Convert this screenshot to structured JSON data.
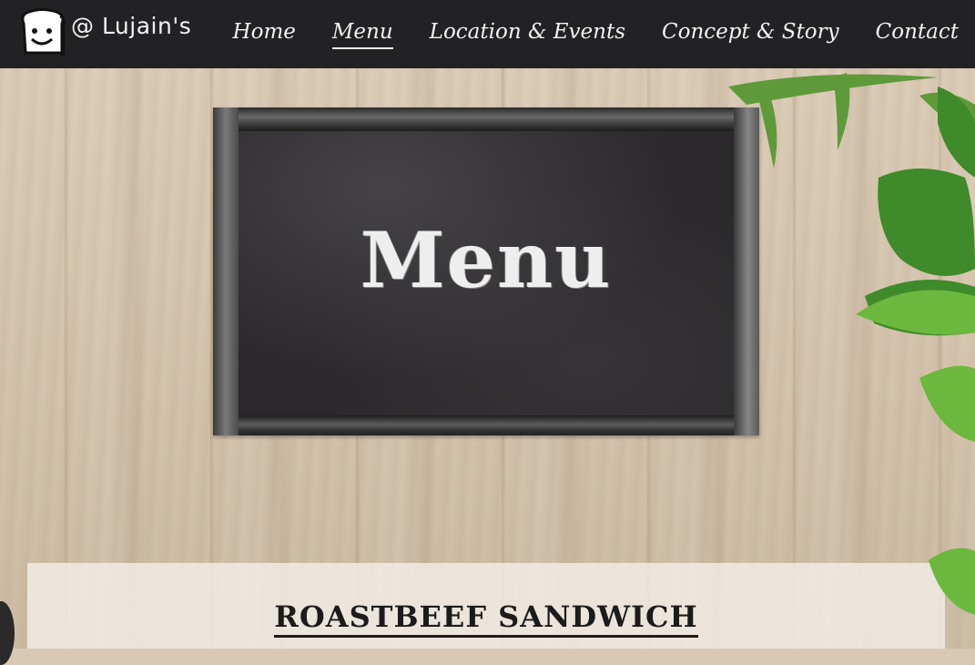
{
  "brand": {
    "name": "@ Lujain's",
    "logo_icon": "toast-smiley-icon"
  },
  "nav": {
    "items": [
      {
        "label": "Home",
        "active": false
      },
      {
        "label": "Menu",
        "active": true
      },
      {
        "label": "Location & Events",
        "active": false
      },
      {
        "label": "Concept & Story",
        "active": false
      },
      {
        "label": "Contact",
        "active": false
      }
    ]
  },
  "hero": {
    "title": "Menu"
  },
  "section": {
    "title": "ROASTBEEF SANDWICH"
  },
  "colors": {
    "navbar": "#222224",
    "nav_text": "#f3f3f3",
    "chalk": "#eeeeee",
    "wood": "#d9c9b4"
  }
}
